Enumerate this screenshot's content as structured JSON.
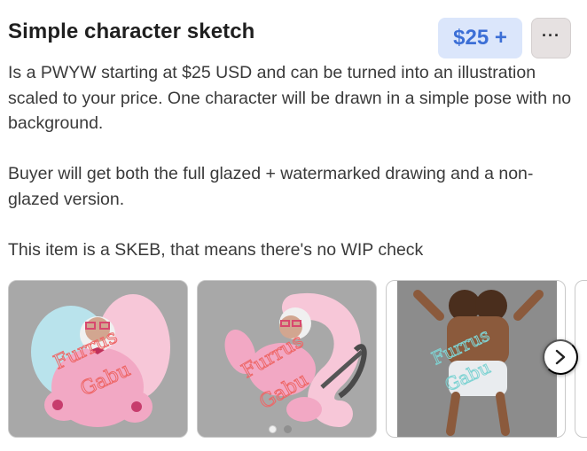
{
  "item": {
    "title": "Simple character sketch",
    "price_label": "$25 +",
    "more_label": "···",
    "description": [
      "Is a PWYW starting at $25 USD and can be turned into an illustration scaled to your price. One character will be drawn in a simple pose with no background.",
      "Buyer will get both the full glazed + watermarked drawing and a non-glazed version.",
      "This item is a SKEB, that means there's no WIP check"
    ]
  },
  "gallery": {
    "images": [
      {
        "icon": "character-sketch-image-1"
      },
      {
        "icon": "character-sketch-image-2"
      },
      {
        "icon": "character-sketch-image-3"
      }
    ],
    "dots_total": 2,
    "active_dot": 1,
    "next_icon": "chevron-right-icon"
  },
  "colors": {
    "price_bg": "#dbe6fb",
    "price_text": "#3c6fd6",
    "more_bg": "#e6e1e1",
    "thumb_bg": "#a9a9a9"
  }
}
